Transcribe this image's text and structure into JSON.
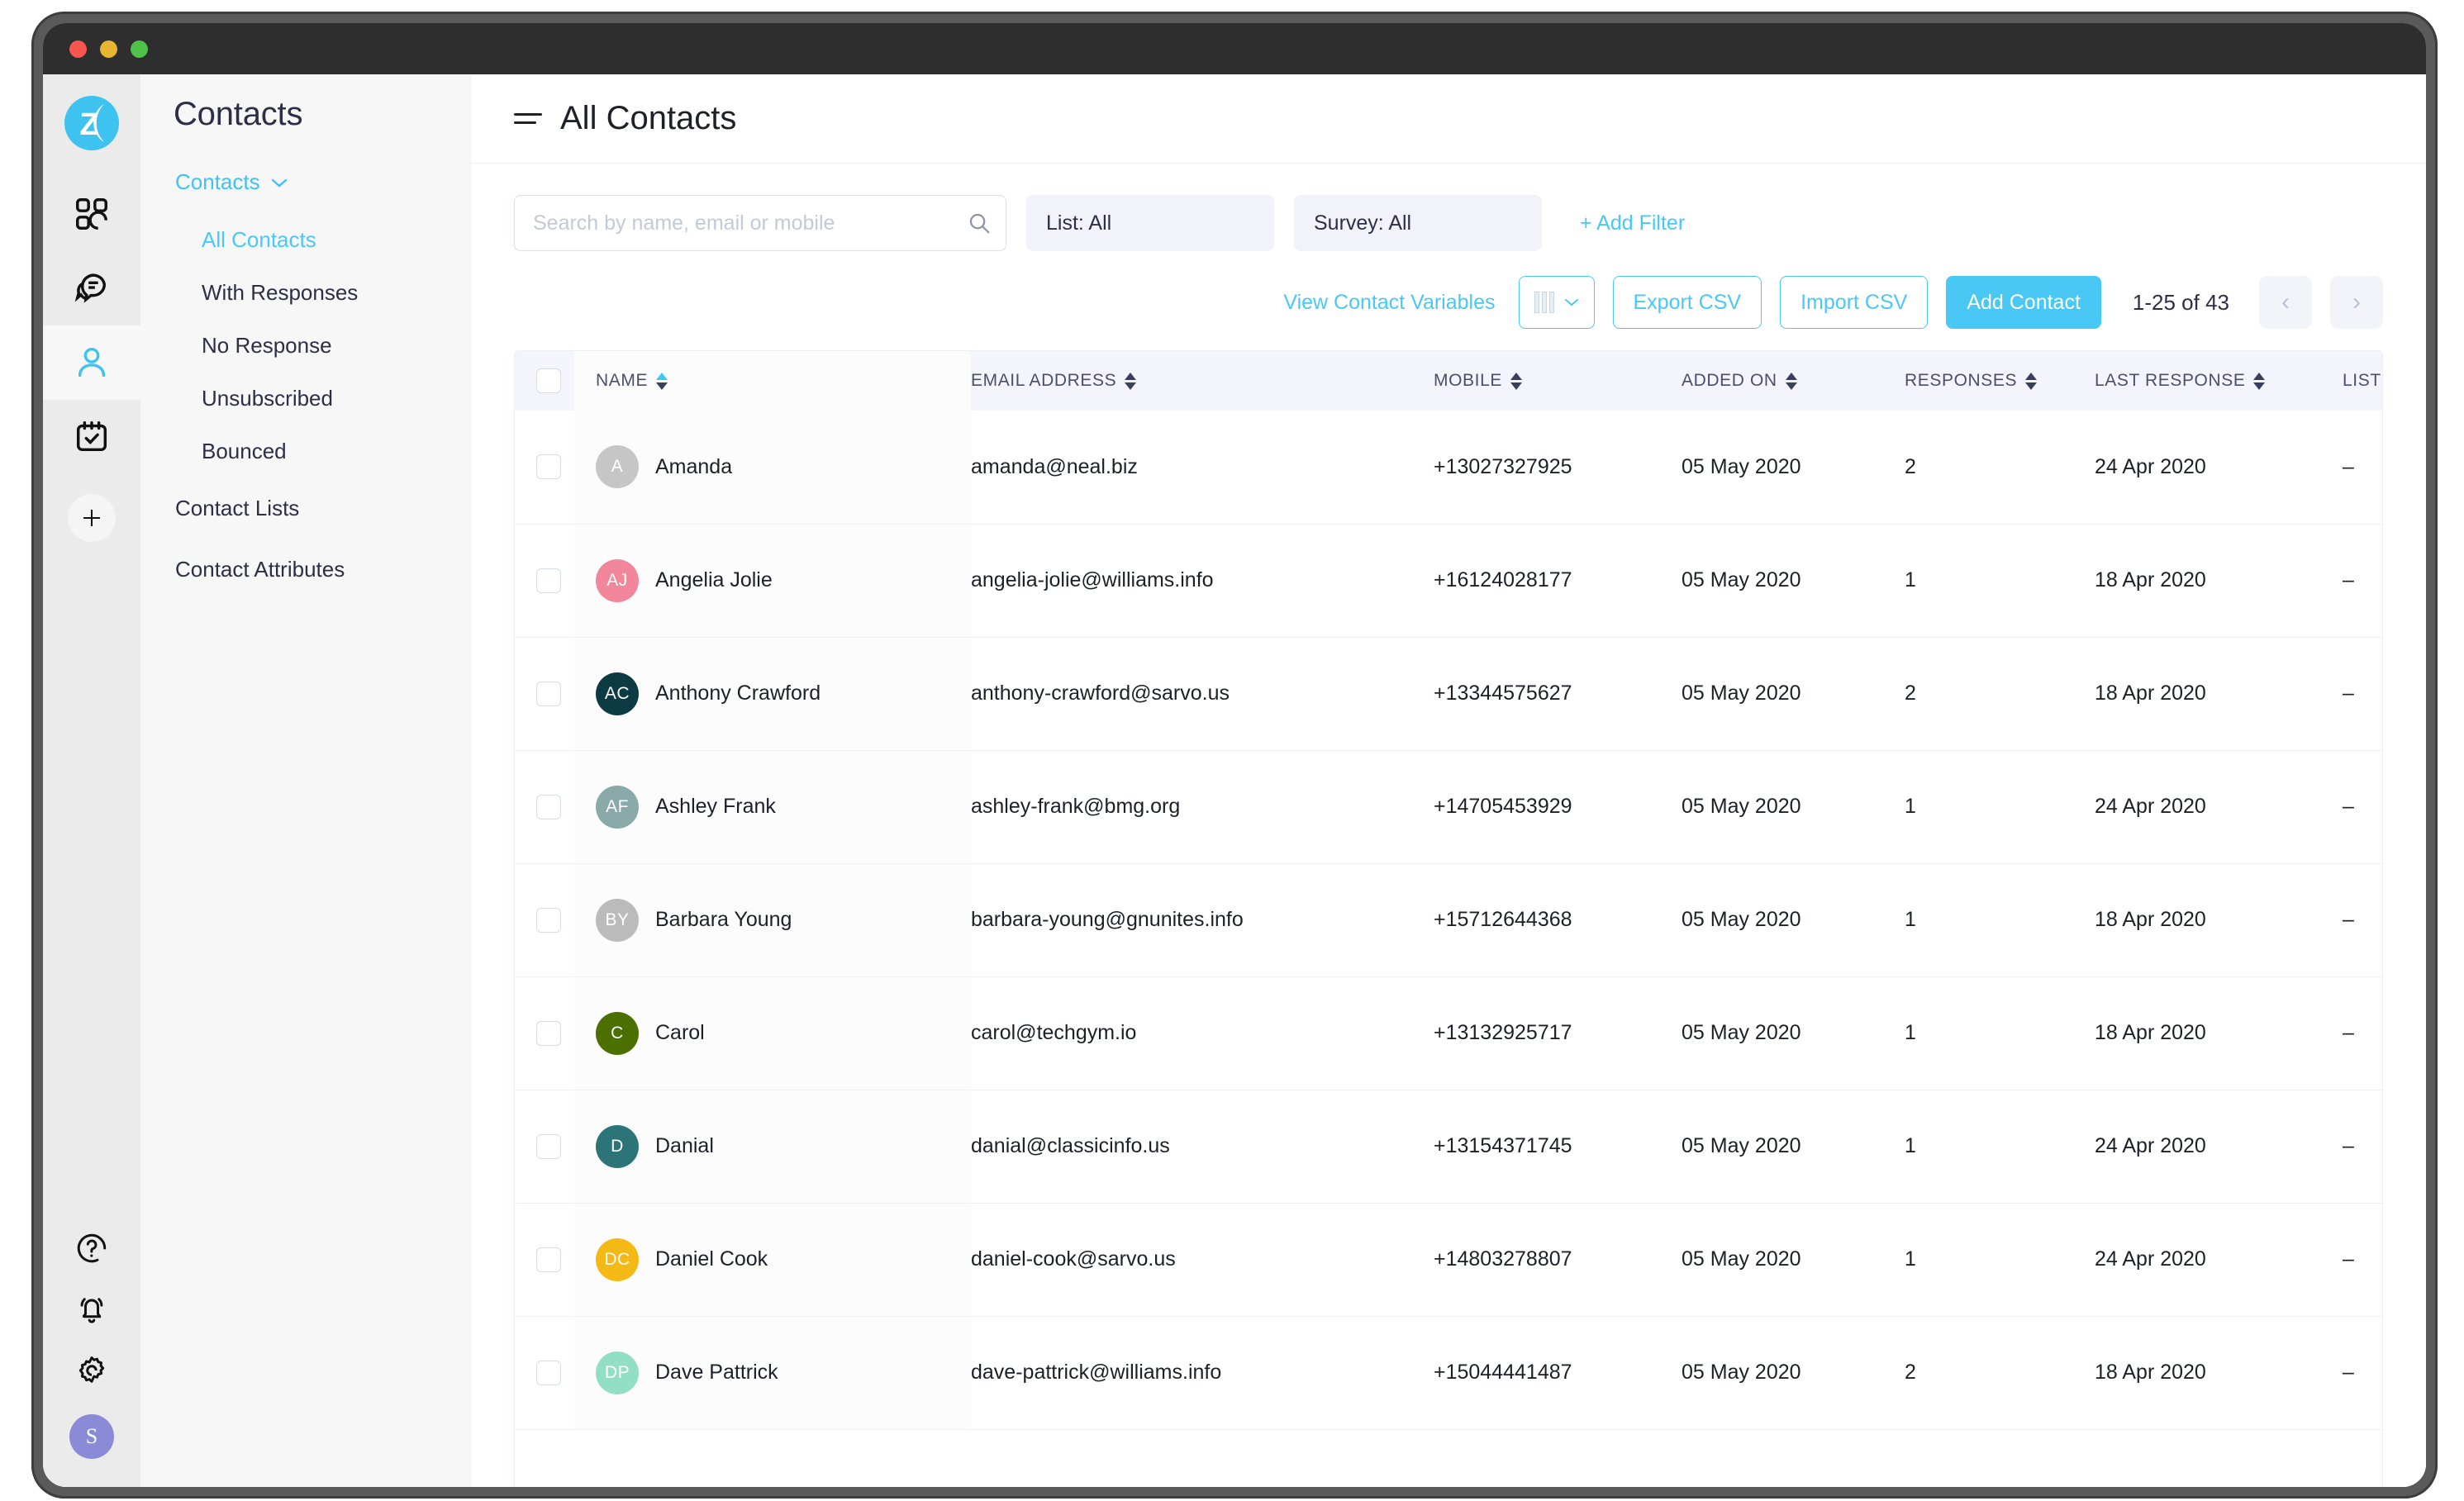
{
  "window": {
    "traffic_lights": [
      "close",
      "minimize",
      "maximize"
    ]
  },
  "rail": {
    "logo_letter": "Z",
    "items": [
      {
        "icon": "grid-dashboard-icon",
        "active": false
      },
      {
        "icon": "chat-bubbles-icon",
        "active": false
      },
      {
        "icon": "person-icon",
        "active": true
      },
      {
        "icon": "calendar-check-icon",
        "active": false
      }
    ],
    "add_button_label": "+",
    "bottom_items": [
      {
        "icon": "help-circle-icon"
      },
      {
        "icon": "bell-icon"
      },
      {
        "icon": "gear-icon"
      }
    ],
    "user_avatar": {
      "initial": "S",
      "color": "#8b8ad6"
    }
  },
  "sidebar": {
    "title": "Contacts",
    "group": {
      "label": "Contacts",
      "expanded": true
    },
    "sub_items": [
      {
        "label": "All Contacts",
        "active": true
      },
      {
        "label": "With Responses",
        "active": false
      },
      {
        "label": "No Response",
        "active": false
      },
      {
        "label": "Unsubscribed",
        "active": false
      },
      {
        "label": "Bounced",
        "active": false
      }
    ],
    "top_items": [
      {
        "label": "Contact Lists"
      },
      {
        "label": "Contact Attributes"
      }
    ]
  },
  "header": {
    "title": "All Contacts",
    "menu_icon": "hamburger-icon"
  },
  "filters": {
    "search_placeholder": "Search by name, email or mobile",
    "search_value": "",
    "search_icon": "search-icon",
    "list_filter": "List: All",
    "survey_filter": "Survey: All",
    "add_filter": "+ Add Filter"
  },
  "actions": {
    "view_contact_variables": "View Contact Variables",
    "columns_icon": "columns-icon",
    "columns_caret": "⌄",
    "export_csv": "Export CSV",
    "import_csv": "Import CSV",
    "add_contact": "Add Contact",
    "pagination": "1-25 of 43",
    "prev_label": "‹",
    "next_label": "›",
    "accent_color": "#4ac8f5"
  },
  "table": {
    "columns": [
      {
        "key": "check",
        "label": "",
        "sortable": false
      },
      {
        "key": "name",
        "label": "NAME",
        "sortable": true,
        "sorted": "asc"
      },
      {
        "key": "email",
        "label": "EMAIL ADDRESS",
        "sortable": true,
        "sorted": "none"
      },
      {
        "key": "mobile",
        "label": "MOBILE",
        "sortable": true,
        "sorted": "none"
      },
      {
        "key": "added",
        "label": "ADDED ON",
        "sortable": true,
        "sorted": "none"
      },
      {
        "key": "resp",
        "label": "RESPONSES",
        "sortable": true,
        "sorted": "none"
      },
      {
        "key": "last",
        "label": "LAST RESPONSE",
        "sortable": true,
        "sorted": "none"
      },
      {
        "key": "lists",
        "label": "LISTS",
        "sortable": false
      }
    ],
    "rows": [
      {
        "initials": "A",
        "avatar_color": "#c6c6c6",
        "name": "Amanda",
        "email": "amanda@neal.biz",
        "mobile": "+13027327925",
        "added_on": "05 May 2020",
        "responses": "2",
        "last_response": "24 Apr 2020",
        "lists": "–"
      },
      {
        "initials": "AJ",
        "avatar_color": "#f2879c",
        "name": "Angelia Jolie",
        "email": "angelia-jolie@williams.info",
        "mobile": "+16124028177",
        "added_on": "05 May 2020",
        "responses": "1",
        "last_response": "18 Apr 2020",
        "lists": "–"
      },
      {
        "initials": "AC",
        "avatar_color": "#0d3b43",
        "name": "Anthony Crawford",
        "email": "anthony-crawford@sarvo.us",
        "mobile": "+13344575627",
        "added_on": "05 May 2020",
        "responses": "2",
        "last_response": "18 Apr 2020",
        "lists": "–"
      },
      {
        "initials": "AF",
        "avatar_color": "#89aaa8",
        "name": "Ashley Frank",
        "email": "ashley-frank@bmg.org",
        "mobile": "+14705453929",
        "added_on": "05 May 2020",
        "responses": "1",
        "last_response": "24 Apr 2020",
        "lists": "–"
      },
      {
        "initials": "BY",
        "avatar_color": "#bbbbbb",
        "name": "Barbara Young",
        "email": "barbara-young@gnunites.info",
        "mobile": "+15712644368",
        "added_on": "05 May 2020",
        "responses": "1",
        "last_response": "18 Apr 2020",
        "lists": "–"
      },
      {
        "initials": "C",
        "avatar_color": "#4b7000",
        "name": "Carol",
        "email": "carol@techgym.io",
        "mobile": "+13132925717",
        "added_on": "05 May 2020",
        "responses": "1",
        "last_response": "18 Apr 2020",
        "lists": "–"
      },
      {
        "initials": "D",
        "avatar_color": "#2c7478",
        "name": "Danial",
        "email": "danial@classicinfo.us",
        "mobile": "+13154371745",
        "added_on": "05 May 2020",
        "responses": "1",
        "last_response": "24 Apr 2020",
        "lists": "–"
      },
      {
        "initials": "DC",
        "avatar_color": "#f5b916",
        "name": "Daniel Cook",
        "email": "daniel-cook@sarvo.us",
        "mobile": "+14803278807",
        "added_on": "05 May 2020",
        "responses": "1",
        "last_response": "24 Apr 2020",
        "lists": "–"
      },
      {
        "initials": "DP",
        "avatar_color": "#93dfc6",
        "name": "Dave Pattrick",
        "email": "dave-pattrick@williams.info",
        "mobile": "+15044441487",
        "added_on": "05 May 2020",
        "responses": "2",
        "last_response": "18 Apr 2020",
        "lists": "–"
      }
    ]
  }
}
